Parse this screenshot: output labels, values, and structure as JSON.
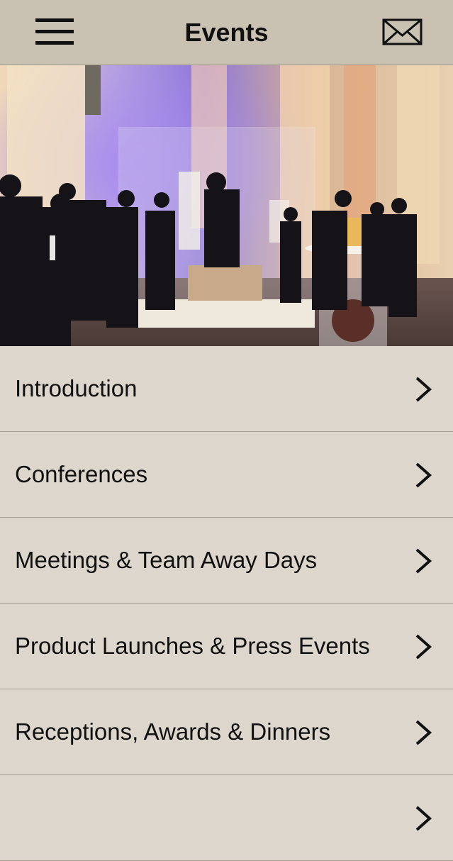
{
  "header": {
    "title": "Events",
    "menu_icon": "hamburger-menu-icon",
    "mail_icon": "envelope-icon"
  },
  "hero": {
    "image": "event-reception-photo"
  },
  "menu": {
    "items": [
      {
        "label": "Introduction"
      },
      {
        "label": "Conferences"
      },
      {
        "label": "Meetings & Team Away Days"
      },
      {
        "label": "Product Launches & Press Events"
      },
      {
        "label": "Receptions, Awards & Dinners"
      },
      {
        "label": ""
      }
    ]
  },
  "colors": {
    "header_bg": "#c9c1b2",
    "list_bg": "#ddd6cd",
    "divider": "#a79f94"
  }
}
